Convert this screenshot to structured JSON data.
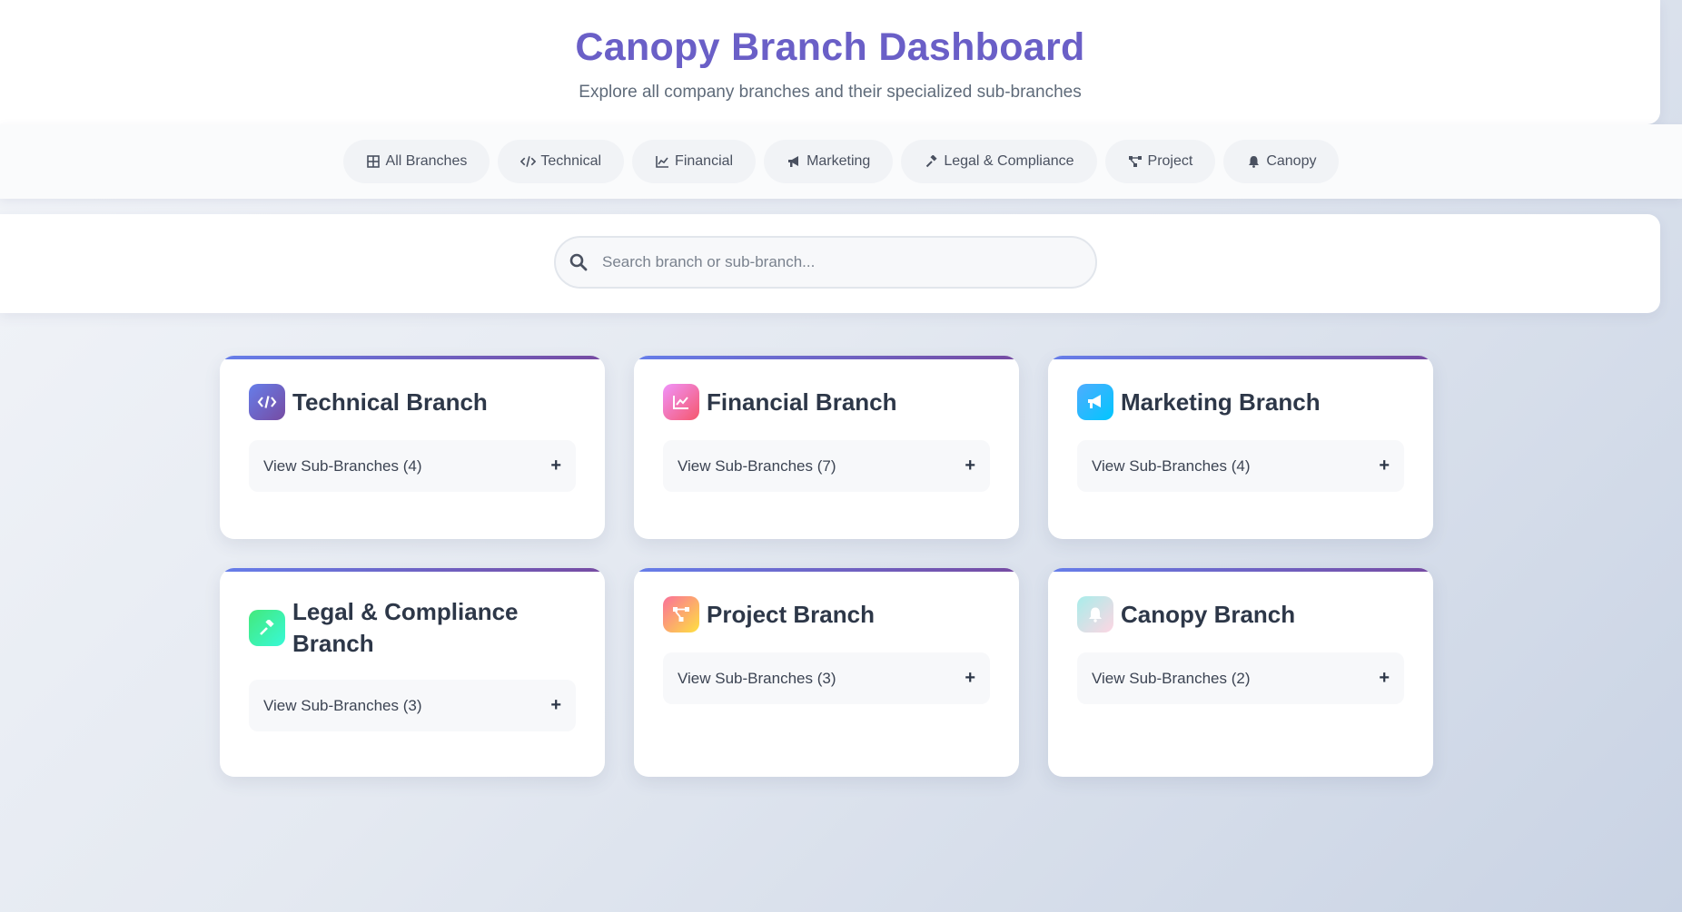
{
  "header": {
    "title": "Canopy Branch Dashboard",
    "subtitle": "Explore all company branches and their specialized sub-branches"
  },
  "nav": [
    {
      "label": "All Branches",
      "icon": "grid-icon"
    },
    {
      "label": "Technical",
      "icon": "code-icon"
    },
    {
      "label": "Financial",
      "icon": "chart-line-icon"
    },
    {
      "label": "Marketing",
      "icon": "megaphone-icon"
    },
    {
      "label": "Legal & Compliance",
      "icon": "gavel-icon"
    },
    {
      "label": "Project",
      "icon": "project-diagram-icon"
    },
    {
      "label": "Canopy",
      "icon": "bell-icon"
    }
  ],
  "search": {
    "placeholder": "Search branch or sub-branch..."
  },
  "cards": [
    {
      "title": "Technical Branch",
      "toggle": "View Sub-Branches (4)",
      "plus": "+",
      "icon": "code-icon",
      "color_from": "#667eea",
      "color_to": "#764ba2"
    },
    {
      "title": "Financial Branch",
      "toggle": "View Sub-Branches (7)",
      "plus": "+",
      "icon": "chart-line-icon",
      "color_from": "#f093fb",
      "color_to": "#f5576c"
    },
    {
      "title": "Marketing Branch",
      "toggle": "View Sub-Branches (4)",
      "plus": "+",
      "icon": "megaphone-icon",
      "color_from": "#4facfe",
      "color_to": "#00f2fe"
    },
    {
      "title": "Legal & Compliance Branch",
      "toggle": "View Sub-Branches (3)",
      "plus": "+",
      "icon": "gavel-icon",
      "color_from": "#43e97b",
      "color_to": "#38f9d7"
    },
    {
      "title": "Project Branch",
      "toggle": "View Sub-Branches (3)",
      "plus": "+",
      "icon": "project-diagram-icon",
      "color_from": "#fa709a",
      "color_to": "#fee140"
    },
    {
      "title": "Canopy Branch",
      "toggle": "View Sub-Branches (2)",
      "plus": "+",
      "icon": "bell-icon",
      "color_from": "#a8edea",
      "color_to": "#fed6e3"
    }
  ]
}
